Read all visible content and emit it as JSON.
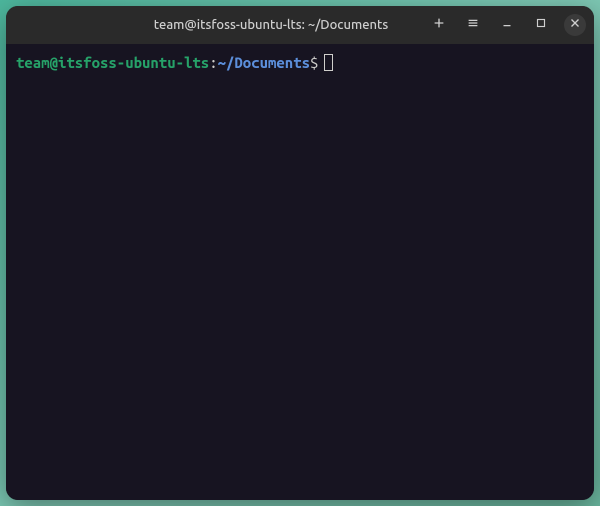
{
  "window": {
    "title": "team@itsfoss-ubuntu-lts: ~/Documents"
  },
  "titlebar": {
    "icons": {
      "new_tab": "plus-icon",
      "menu": "hamburger-icon",
      "minimize": "minimize-icon",
      "maximize": "maximize-icon",
      "close": "close-icon"
    }
  },
  "prompt": {
    "user_host": "team@itsfoss-ubuntu-lts",
    "colon": ":",
    "cwd": "~/Documents",
    "symbol": "$"
  },
  "colors": {
    "bg": "#171421",
    "titlebar": "#2a2a2a",
    "user_host": "#26a269",
    "cwd": "#5c8fdb",
    "text": "#d0cfcc"
  }
}
